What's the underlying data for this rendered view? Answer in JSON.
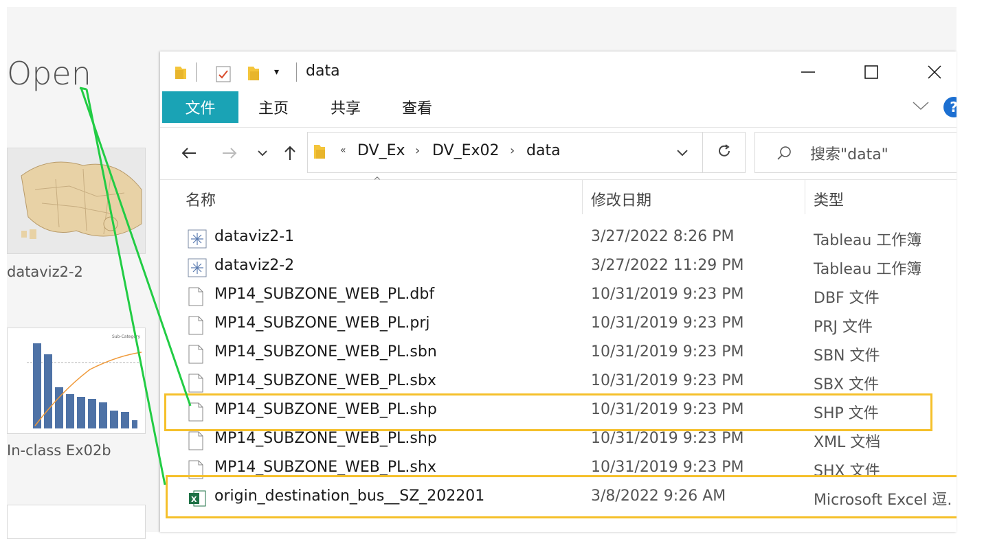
{
  "tableau": {
    "open_label": "Open",
    "workbooks": [
      {
        "label": "dataviz2-2"
      },
      {
        "label": "In-class Ex02b"
      }
    ],
    "chart_thumb": {
      "legend_label": "Sub-Category"
    }
  },
  "window": {
    "title": "data",
    "minimize": "—",
    "maximize": "☐",
    "close": "✕"
  },
  "ribbon": {
    "tabs": [
      "文件",
      "主页",
      "共享",
      "查看"
    ],
    "expand": "∨",
    "help": "?"
  },
  "nav": {
    "back": "←",
    "forward": "→",
    "recent": "∨",
    "up": "↑",
    "overflow": "«",
    "breadcrumb": [
      "DV_Ex",
      "DV_Ex02",
      "data"
    ],
    "breadcrumb_sep": "›",
    "dropdown": "∨",
    "refresh": "↻",
    "search_placeholder": "搜索\"data\""
  },
  "columns": {
    "name": "名称",
    "modified": "修改日期",
    "type": "类型",
    "sort_indicator": "^"
  },
  "files": [
    {
      "name": "dataviz2-1",
      "date": "3/27/2022 8:26 PM",
      "type": "Tableau 工作簿",
      "icon": "tableau-icon"
    },
    {
      "name": "dataviz2-2",
      "date": "3/27/2022 11:29 PM",
      "type": "Tableau 工作簿",
      "icon": "tableau-icon"
    },
    {
      "name": "MP14_SUBZONE_WEB_PL.dbf",
      "date": "10/31/2019 9:23 PM",
      "type": "DBF 文件",
      "icon": "file-icon"
    },
    {
      "name": "MP14_SUBZONE_WEB_PL.prj",
      "date": "10/31/2019 9:23 PM",
      "type": "PRJ 文件",
      "icon": "file-icon"
    },
    {
      "name": "MP14_SUBZONE_WEB_PL.sbn",
      "date": "10/31/2019 9:23 PM",
      "type": "SBN 文件",
      "icon": "file-icon"
    },
    {
      "name": "MP14_SUBZONE_WEB_PL.sbx",
      "date": "10/31/2019 9:23 PM",
      "type": "SBX 文件",
      "icon": "file-icon"
    },
    {
      "name": "MP14_SUBZONE_WEB_PL.shp",
      "date": "10/31/2019 9:23 PM",
      "type": "SHP 文件",
      "icon": "file-icon"
    },
    {
      "name": "MP14_SUBZONE_WEB_PL.shp",
      "date": "10/31/2019 9:23 PM",
      "type": "XML 文档",
      "icon": "file-icon"
    },
    {
      "name": "MP14_SUBZONE_WEB_PL.shx",
      "date": "10/31/2019 9:23 PM",
      "type": "SHX 文件",
      "icon": "file-icon"
    },
    {
      "name": "origin_destination_bus__SZ_202201",
      "date": "3/8/2022 9:26 AM",
      "type": "Microsoft Excel 逗.",
      "icon": "excel-icon"
    }
  ],
  "annotation": {
    "highlight_color": "#f5c02a",
    "arrow_color": "#22cc44"
  },
  "colors": {
    "ribbon_file_tab": "#1aa3b5",
    "folder": "#f4c53b"
  }
}
